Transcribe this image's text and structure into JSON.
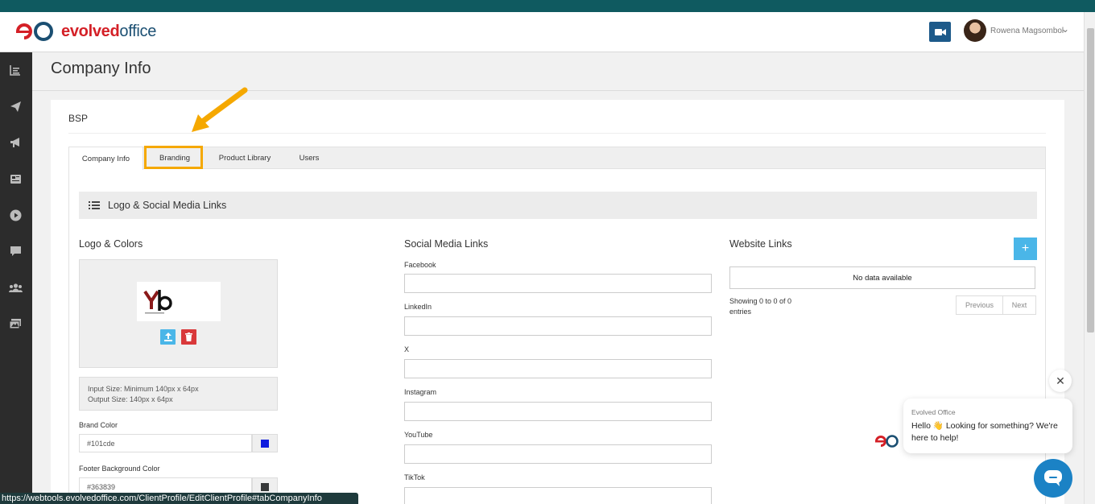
{
  "header": {
    "logo_prefix": "evolved",
    "logo_suffix": "office",
    "user_name": "Rowena Magsombol"
  },
  "sidebar": {
    "icons": [
      "dashboard-icon",
      "send-icon",
      "megaphone-icon",
      "newspaper-icon",
      "play-icon",
      "comment-icon",
      "users-icon",
      "images-icon"
    ]
  },
  "page": {
    "title": "Company Info",
    "company_name": "BSP"
  },
  "tabs": [
    {
      "label": "Company Info",
      "active": true
    },
    {
      "label": "Branding",
      "active": false,
      "highlighted": true
    },
    {
      "label": "Product Library",
      "active": false
    },
    {
      "label": "Users",
      "active": false
    }
  ],
  "section": {
    "title": "Logo & Social Media Links"
  },
  "logo_colors": {
    "title": "Logo & Colors",
    "input_size": "Input Size: Minimum 140px x 64px",
    "output_size": "Output Size: 140px x 64px",
    "brand_color_label": "Brand Color",
    "brand_color_value": "#101cde",
    "footer_bg_label": "Footer Background Color",
    "footer_bg_value": "#363839"
  },
  "social": {
    "title": "Social Media Links",
    "fields": [
      "Facebook",
      "LinkedIn",
      "X",
      "Instagram",
      "YouTube",
      "TikTok"
    ]
  },
  "website": {
    "title": "Website Links",
    "add_label": "+",
    "empty_text": "No data available",
    "showing_text": "Showing 0 to 0 of 0 entries",
    "previous": "Previous",
    "next": "Next"
  },
  "chat": {
    "from": "Evolved Office",
    "message": "Hello 👋 Looking for something? We're here to help!",
    "close": "✕"
  },
  "status_url": "https://webtools.evolvedoffice.com/ClientProfile/EditClientProfile#tabCompanyInfo",
  "colors": {
    "accent_yellow": "#f5a800",
    "brand_red": "#d42027",
    "brand_blue": "#1b4f72",
    "sidebar": "#2c2c2c",
    "topbar": "#0f5a60"
  }
}
